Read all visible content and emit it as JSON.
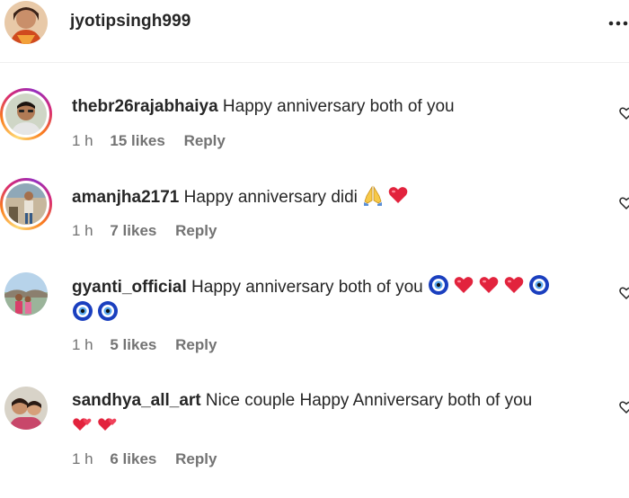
{
  "post": {
    "username": "jyotipsingh999"
  },
  "comments": [
    {
      "username": "thebr26rajabhaiya",
      "text": "Happy anniversary both of you",
      "time": "1 h",
      "likes": "15 likes",
      "reply": "Reply",
      "has_story_ring": true
    },
    {
      "username": "amanjha2171",
      "text": "Happy anniversary didi",
      "emojis": [
        "folded-hands",
        "red-heart"
      ],
      "time": "1 h",
      "likes": "7 likes",
      "reply": "Reply",
      "has_story_ring": true
    },
    {
      "username": "gyanti_official",
      "text": "Happy anniversary both of you",
      "emojis": [
        "nazar-amulet",
        "red-heart",
        "red-heart",
        "red-heart",
        "nazar-amulet",
        "nazar-amulet",
        "nazar-amulet"
      ],
      "time": "1 h",
      "likes": "5 likes",
      "reply": "Reply",
      "has_story_ring": false
    },
    {
      "username": "sandhya_all_art",
      "text": "Nice couple Happy Anniversary both of you",
      "emojis": [
        "two-hearts",
        "two-hearts"
      ],
      "time": "1 h",
      "likes": "6 likes",
      "reply": "Reply",
      "has_story_ring": false
    }
  ],
  "colors": {
    "text": "#262626",
    "secondary": "#737373",
    "divider": "#efefef",
    "heart": "#e0245e",
    "nazar": "#1a3fbf"
  }
}
